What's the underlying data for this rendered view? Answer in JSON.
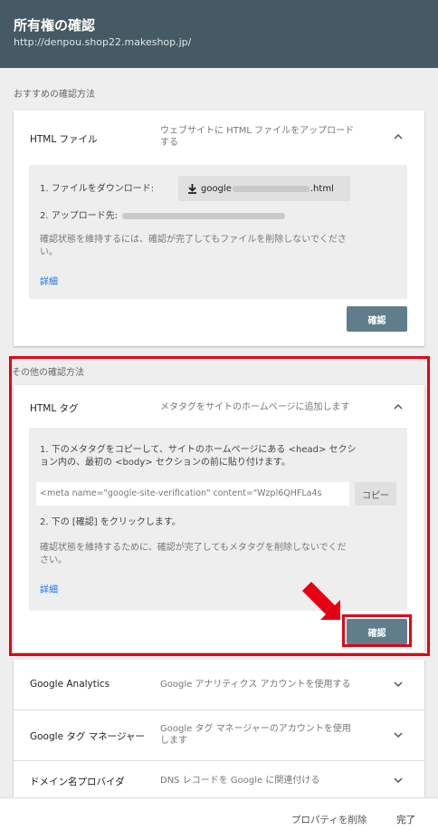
{
  "header": {
    "title": "所有権の確認",
    "url": "http://denpou.shop22.makeshop.jp/"
  },
  "recommended": {
    "label": "おすすめの確認方法",
    "method": {
      "title": "HTML ファイル",
      "desc_line1": "ウェブサイトに HTML ファイルをアップロード",
      "desc_line2": "する",
      "step1_label": "1. ファイルをダウンロード:",
      "download_prefix": "google",
      "download_suffix": ".html",
      "step2_label": "2. アップロード先:",
      "keep_line1": "確認状態を維持するには、確認が完了してもファイルを削除しないでくださ",
      "keep_line2": "い。",
      "details": "詳細",
      "verify": "確認"
    }
  },
  "other": {
    "label": "その他の確認方法",
    "html_tag": {
      "title": "HTML タグ",
      "desc": "メタタグをサイトのホームページに追加します",
      "step1_line1": "1. 下のメタタグをコピーして、サイトのホームページにある <head> セクシ",
      "step1_line2": "ョン内の、最初の <body> セクションの前に貼り付けます。",
      "meta_value": "<meta name=\"google-site-verification\" content=\"Wzpl6QHFLa4s",
      "copy": "コピー",
      "step2": "2. 下の [確認] をクリックします。",
      "keep_line1": "確認状態を維持するために、確認が完了してもメタタグを削除しないでくだ",
      "keep_line2": "さい。",
      "details": "詳細",
      "verify": "確認"
    },
    "methods": [
      {
        "title": "Google Analytics",
        "desc1": "Google アナリティクス アカウントを使用する",
        "desc2": ""
      },
      {
        "title": "Google タグ マネージャー",
        "desc1": "Google タグ マネージャーのアカウントを使用",
        "desc2": "します"
      },
      {
        "title": "ドメイン名プロバイダ",
        "desc1": "DNS レコードを Google に関連付ける",
        "desc2": ""
      }
    ]
  },
  "footer": {
    "delete": "プロパティを削除",
    "done": "完了"
  },
  "colors": {
    "header": "#455a64",
    "primary_button": "#607d8b",
    "highlight": "#e60012",
    "link": "#1a73e8"
  }
}
